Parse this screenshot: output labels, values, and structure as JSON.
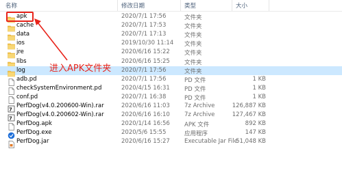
{
  "columns": {
    "name": "名称",
    "date": "修改日期",
    "type": "类型",
    "size": "大小"
  },
  "rows": [
    {
      "name": "apk",
      "date": "2020/7/1 17:56",
      "type": "文件夹",
      "size": "",
      "icon": "folder-icon"
    },
    {
      "name": "cache",
      "date": "2020/7/1 17:53",
      "type": "文件夹",
      "size": "",
      "icon": "folder-icon"
    },
    {
      "name": "data",
      "date": "2020/7/1 17:13",
      "type": "文件夹",
      "size": "",
      "icon": "folder-icon"
    },
    {
      "name": "ios",
      "date": "2019/10/30 11:14",
      "type": "文件夹",
      "size": "",
      "icon": "folder-icon"
    },
    {
      "name": "jre",
      "date": "2020/6/16 15:22",
      "type": "文件夹",
      "size": "",
      "icon": "folder-icon"
    },
    {
      "name": "libs",
      "date": "2020/6/16 15:25",
      "type": "文件夹",
      "size": "",
      "icon": "folder-icon"
    },
    {
      "name": "log",
      "date": "2020/7/1 17:56",
      "type": "文件夹",
      "size": "",
      "icon": "folder-icon"
    },
    {
      "name": "adb.pd",
      "date": "2020/7/1 17:56",
      "type": "PD 文件",
      "size": "1 KB",
      "icon": "file-icon"
    },
    {
      "name": "checkSystemEnvironment.pd",
      "date": "2020/4/15 16:31",
      "type": "PD 文件",
      "size": "1 KB",
      "icon": "file-icon"
    },
    {
      "name": "conf.pd",
      "date": "2020/7/1 16:38",
      "type": "PD 文件",
      "size": "1 KB",
      "icon": "file-icon"
    },
    {
      "name": "PerfDog(v4.0.200600-Win).rar",
      "date": "2020/6/16 11:03",
      "type": "7z Archive",
      "size": "126,887 KB",
      "icon": "archive-icon"
    },
    {
      "name": "PerfDog(v4.0.200602-Win).rar",
      "date": "2020/6/16 16:10",
      "type": "7z Archive",
      "size": "127,467 KB",
      "icon": "archive-icon"
    },
    {
      "name": "PerfDog.apk",
      "date": "2020/1/14 16:56",
      "type": "APK 文件",
      "size": "892 KB",
      "icon": "file-icon"
    },
    {
      "name": "PerfDog.exe",
      "date": "2020/5/6 15:55",
      "type": "应用程序",
      "size": "147 KB",
      "icon": "app-icon"
    },
    {
      "name": "PerfDog.jar",
      "date": "2020/6/16 15:27",
      "type": "Executable Jar File",
      "size": "51,048 KB",
      "icon": "jar-icon"
    }
  ],
  "annotation": {
    "text": "进入APK文件夹"
  },
  "colors": {
    "highlight": "#cce8ff",
    "annotation_red": "#e8231a",
    "folder": "#f4c64e"
  }
}
